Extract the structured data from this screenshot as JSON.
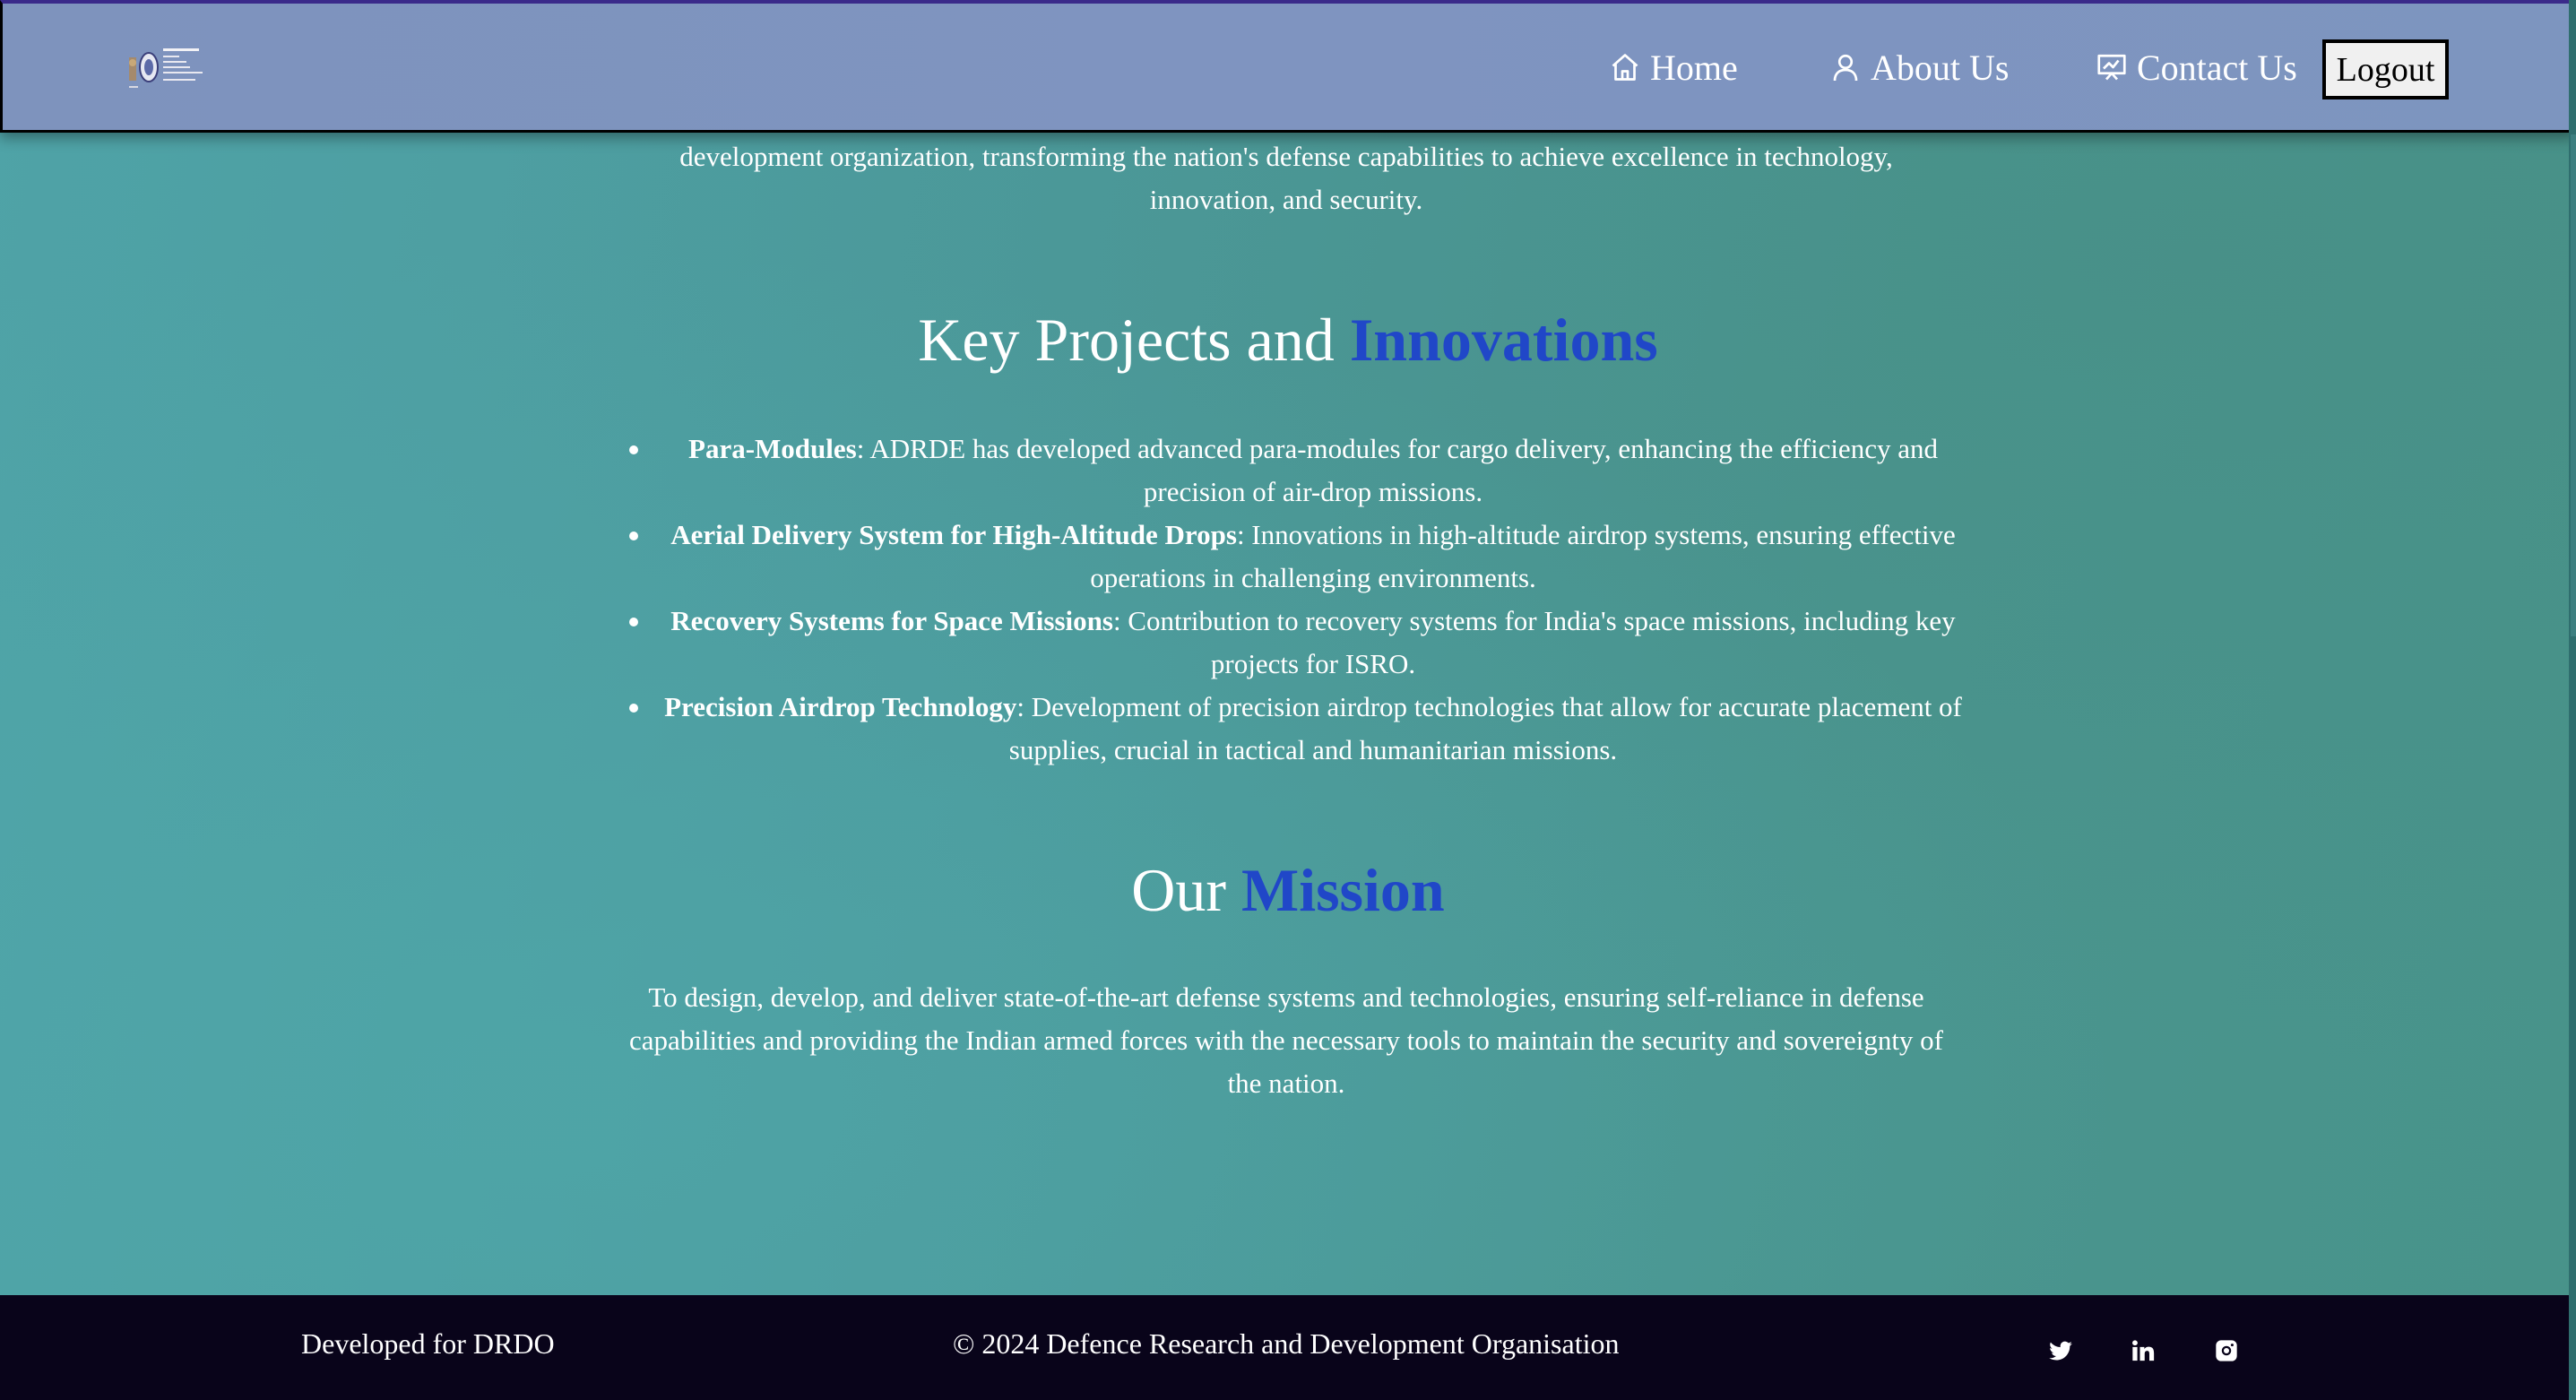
{
  "header": {
    "logo_alt": "DRDO ADRDE logo",
    "nav": {
      "home": "Home",
      "about": "About Us",
      "contact": "Contact Us"
    },
    "logout_label": "Logout"
  },
  "intro": {
    "line1": "development organization, transforming the nation's defense capabilities to achieve excellence in technology,",
    "line2": "innovation, and security."
  },
  "projects": {
    "title_plain": "Key Projects and ",
    "title_accent": "Innovations",
    "items": [
      {
        "name": "Para-Modules",
        "text": ": ADRDE has developed advanced para-modules for cargo delivery, enhancing the efficiency and precision of air-drop missions."
      },
      {
        "name": "Aerial Delivery System for High-Altitude Drops",
        "text": ": Innovations in high-altitude airdrop systems, ensuring effective operations in challenging environments."
      },
      {
        "name": "Recovery Systems for Space Missions",
        "text": ": Contribution to recovery systems for India's space missions, including key projects for ISRO."
      },
      {
        "name": "Precision Airdrop Technology",
        "text": ": Development of precision airdrop technologies that allow for accurate placement of supplies, crucial in tactical and humanitarian missions."
      }
    ]
  },
  "mission": {
    "title_plain": "Our ",
    "title_accent": "Mission",
    "text": "To design, develop, and deliver state-of-the-art defense systems and technologies, ensuring self-reliance in defense capabilities and providing the Indian armed forces with the necessary tools to maintain the security and sovereignty of the nation."
  },
  "footer": {
    "left": "Developed for DRDO",
    "center": "© 2024 Defence Research and Development Organisation",
    "social_icons": [
      "twitter-icon",
      "linkedin-icon",
      "instagram-icon"
    ]
  },
  "colors": {
    "accent": "#2047c8",
    "header_bg": "#7e93bd",
    "footer_bg": "#09041a",
    "page_bg": "#4c9a9c"
  }
}
